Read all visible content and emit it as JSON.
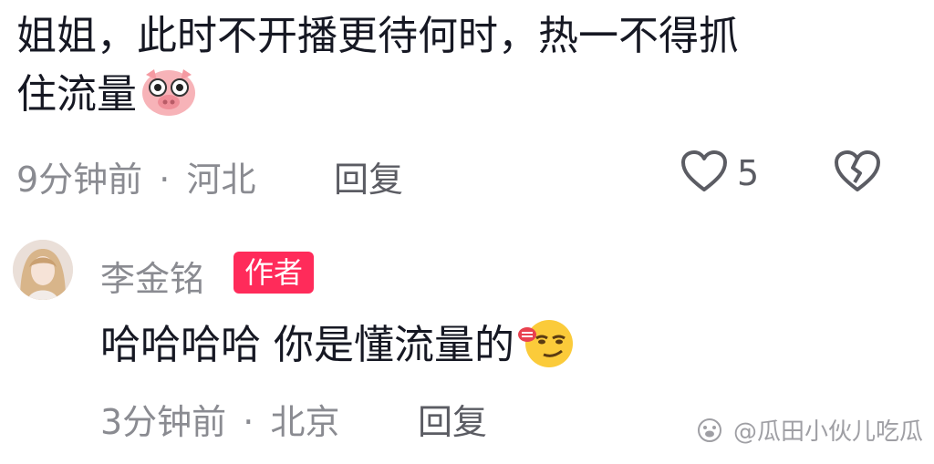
{
  "comment": {
    "text_line1": "姐姐，此时不开播更待何时，热一不得抓",
    "text_line2": "住流量",
    "emoji_icon": "pig-face-icon",
    "time": "9分钟前",
    "separator": "·",
    "location": "河北",
    "reply_label": "回复",
    "like_count": "5"
  },
  "reply_comment": {
    "author_name": "李金铭",
    "author_badge": "作者",
    "text": "哈哈哈哈 你是懂流量的",
    "emoji_icon": "smirk-face-icon",
    "time": "3分钟前",
    "separator": "·",
    "location": "北京",
    "reply_label": "回复"
  },
  "watermark": {
    "text": "@瓜田小伙儿吃瓜"
  },
  "colors": {
    "badge": "#ff2b5a",
    "text": "#161823",
    "meta": "#8a8b91"
  }
}
